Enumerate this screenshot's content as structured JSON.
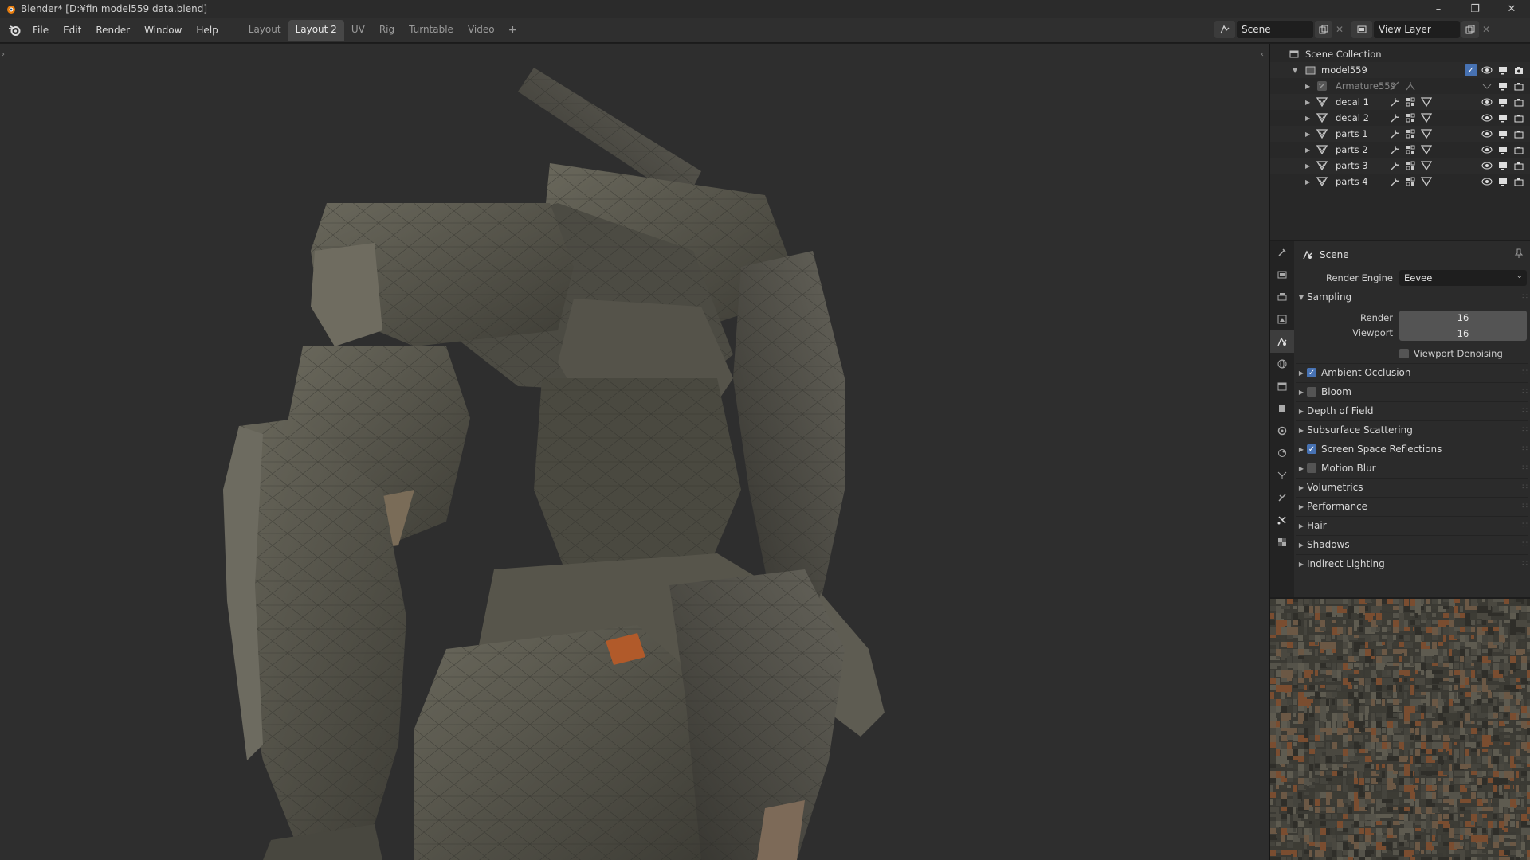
{
  "window": {
    "title": "Blender* [D:¥fin model559 data.blend]",
    "controls": {
      "minimize": "–",
      "maximize": "❐",
      "close": "✕"
    }
  },
  "menu": [
    "File",
    "Edit",
    "Render",
    "Window",
    "Help"
  ],
  "workspaces": [
    {
      "label": "Layout",
      "active": false
    },
    {
      "label": "Layout 2",
      "active": true
    },
    {
      "label": "UV",
      "active": false
    },
    {
      "label": "Rig",
      "active": false
    },
    {
      "label": "Turntable",
      "active": false
    },
    {
      "label": "Video",
      "active": false
    }
  ],
  "workspace_add": "+",
  "scene_selector": {
    "value": "Scene"
  },
  "view_layer_selector": {
    "value": "View Layer"
  },
  "outliner": {
    "root": "Scene Collection",
    "collection": "model559",
    "items": [
      {
        "label": "Armature559",
        "type": "armature-icon",
        "dim": true
      },
      {
        "label": "decal 1",
        "type": "mesh-icon",
        "dim": false
      },
      {
        "label": "decal 2",
        "type": "mesh-icon",
        "dim": false
      },
      {
        "label": "parts 1",
        "type": "mesh-icon",
        "dim": false
      },
      {
        "label": "parts 2",
        "type": "mesh-icon",
        "dim": false
      },
      {
        "label": "parts 3",
        "type": "mesh-icon",
        "dim": false
      },
      {
        "label": "parts 4",
        "type": "mesh-icon",
        "dim": false
      }
    ]
  },
  "properties": {
    "header": "Scene",
    "render_engine": {
      "label": "Render Engine",
      "value": "Eevee"
    },
    "sampling": {
      "title": "Sampling",
      "render_label": "Render",
      "render_value": "16",
      "viewport_label": "Viewport",
      "viewport_value": "16",
      "denoise_label": "Viewport Denoising",
      "denoise_checked": false
    },
    "panels": [
      {
        "label": "Ambient Occlusion",
        "checkbox": true,
        "checked": true
      },
      {
        "label": "Bloom",
        "checkbox": true,
        "checked": false
      },
      {
        "label": "Depth of Field",
        "checkbox": false
      },
      {
        "label": "Subsurface Scattering",
        "checkbox": false
      },
      {
        "label": "Screen Space Reflections",
        "checkbox": true,
        "checked": true
      },
      {
        "label": "Motion Blur",
        "checkbox": true,
        "checked": false
      },
      {
        "label": "Volumetrics",
        "checkbox": false
      },
      {
        "label": "Performance",
        "checkbox": false
      },
      {
        "label": "Hair",
        "checkbox": false
      },
      {
        "label": "Shadows",
        "checkbox": false
      },
      {
        "label": "Indirect Lighting",
        "checkbox": false
      }
    ]
  },
  "colors": {
    "accent": "#4772b3",
    "viewport_bg": "#2e2e2e",
    "model_base": "#5b5a4f"
  }
}
